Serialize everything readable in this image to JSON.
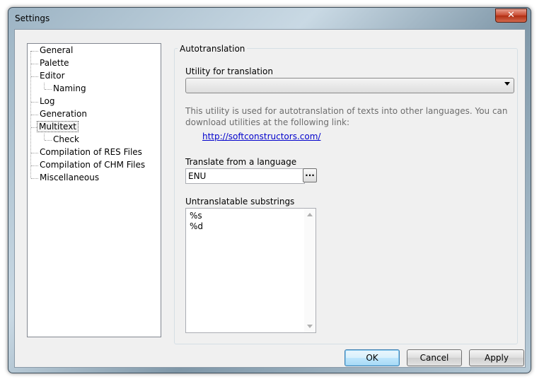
{
  "window": {
    "title": "Settings",
    "close_label": "✕"
  },
  "tree": {
    "items": [
      {
        "label": "General"
      },
      {
        "label": "Palette"
      },
      {
        "label": "Editor"
      },
      {
        "label": "Naming"
      },
      {
        "label": "Log"
      },
      {
        "label": "Generation"
      },
      {
        "label": "Multitext",
        "selected": true
      },
      {
        "label": "Check"
      },
      {
        "label": "Compilation of RES Files"
      },
      {
        "label": "Compilation of CHM Files"
      },
      {
        "label": "Miscellaneous"
      }
    ]
  },
  "panel": {
    "group_title": "Autotranslation",
    "utility_label": "Utility for translation",
    "utility_value": "",
    "description": "This utility is used for autotranslation of texts into other languages. You can download utilities at the following link:",
    "link": "http://softconstructors.com/",
    "language_label": "Translate from a language",
    "language_value": "ENU",
    "browse_label": "...",
    "substrings_label": "Untranslatable substrings",
    "substrings": [
      "%s",
      "%d"
    ]
  },
  "buttons": {
    "ok": "OK",
    "cancel": "Cancel",
    "apply": "Apply"
  }
}
